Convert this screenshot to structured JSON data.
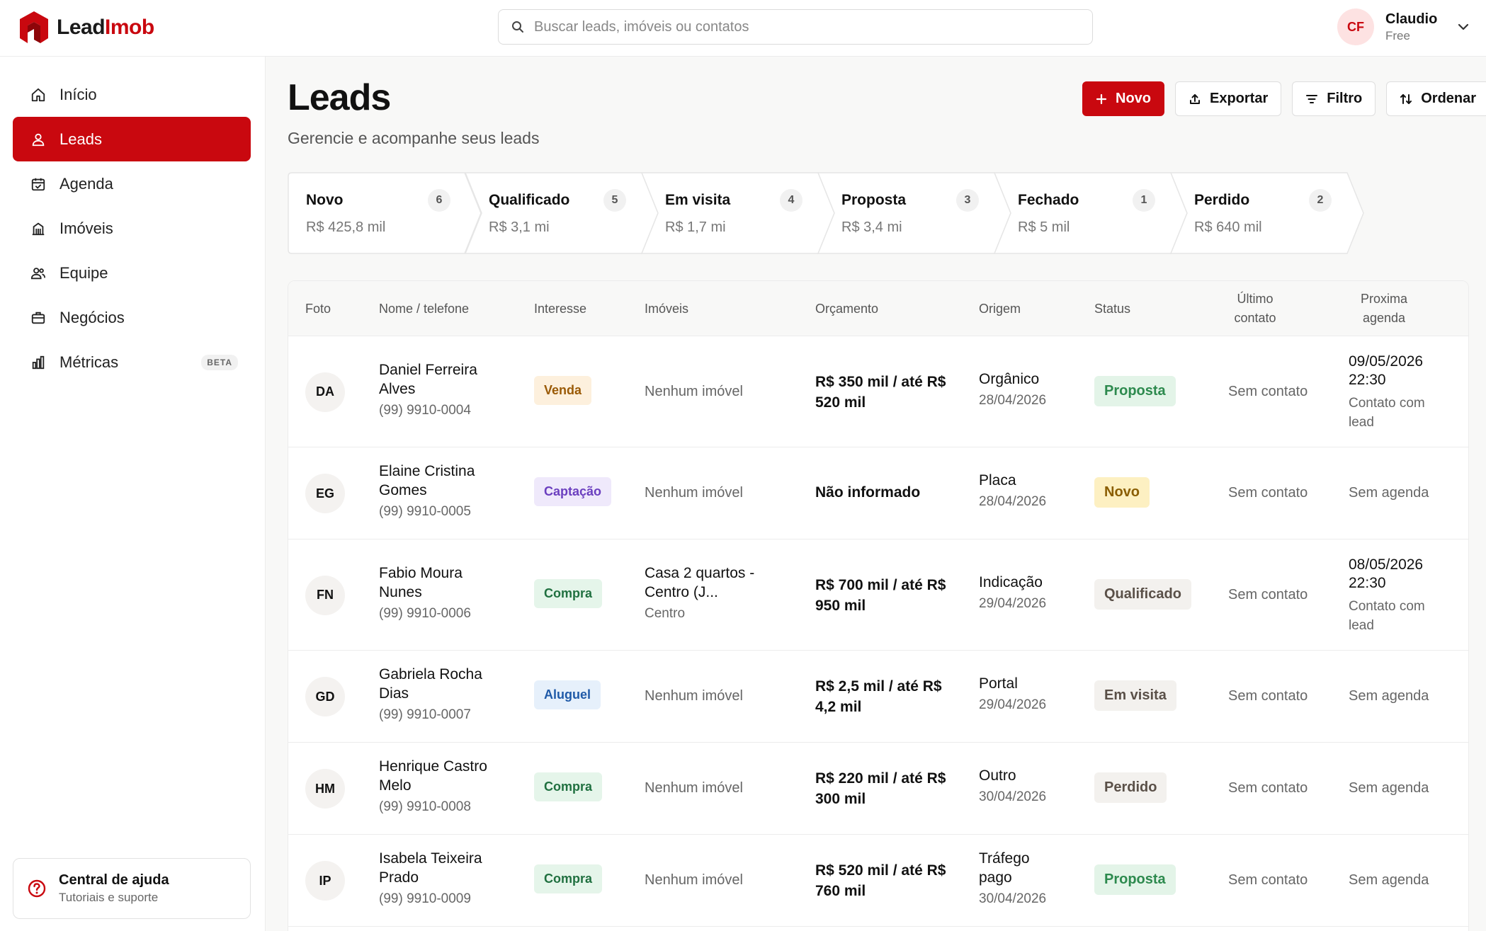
{
  "app": {
    "logo_a": "Lead",
    "logo_b": "Imob"
  },
  "search": {
    "placeholder": "Buscar leads, imóveis ou contatos"
  },
  "user": {
    "initials": "CF",
    "name": "Claudio",
    "plan": "Free"
  },
  "sidebar": {
    "items": [
      {
        "label": "Início",
        "icon": "home-icon"
      },
      {
        "label": "Leads",
        "icon": "user-icon",
        "active": true
      },
      {
        "label": "Agenda",
        "icon": "calendar-icon"
      },
      {
        "label": "Imóveis",
        "icon": "building-icon"
      },
      {
        "label": "Equipe",
        "icon": "users-icon"
      },
      {
        "label": "Negócios",
        "icon": "briefcase-icon"
      },
      {
        "label": "Métricas",
        "icon": "bar-chart-icon",
        "badge": "BETA"
      }
    ],
    "help": {
      "title": "Central de ajuda",
      "subtitle": "Tutoriais e suporte"
    }
  },
  "header": {
    "title": "Leads",
    "subtitle": "Gerencie e acompanhe seus leads"
  },
  "actions": {
    "new": "Novo",
    "export": "Exportar",
    "filter": "Filtro",
    "sort": "Ordenar"
  },
  "pipeline": [
    {
      "name": "Novo",
      "count": "6",
      "value": "R$ 425,8 mil"
    },
    {
      "name": "Qualificado",
      "count": "5",
      "value": "R$ 3,1 mi"
    },
    {
      "name": "Em visita",
      "count": "4",
      "value": "R$ 1,7 mi"
    },
    {
      "name": "Proposta",
      "count": "3",
      "value": "R$ 3,4 mi"
    },
    {
      "name": "Fechado",
      "count": "1",
      "value": "R$ 5 mil"
    },
    {
      "name": "Perdido",
      "count": "2",
      "value": "R$ 640 mil"
    }
  ],
  "table": {
    "headers": {
      "photo": "Foto",
      "name": "Nome / telefone",
      "interest": "Interesse",
      "properties": "Imóveis",
      "budget": "Orçamento",
      "origin": "Origem",
      "status": "Status",
      "last_contact_1": "Último",
      "last_contact_2": "contato",
      "next_1": "Proxima",
      "next_2": "agenda"
    },
    "rows": [
      {
        "initials": "DA",
        "name": "Daniel Ferreira Alves",
        "phone": "(99) 9910-0004",
        "interest": "Venda",
        "property": "Nenhum imóvel",
        "property_sub": "",
        "budget": "R$ 350 mil / até R$ 520 mil",
        "origin": "Orgânico",
        "origin_date": "28/04/2026",
        "status": "Proposta",
        "last_contact": "Sem contato",
        "agenda_date": "09/05/2026 22:30",
        "agenda_note": "Contato com lead"
      },
      {
        "initials": "EG",
        "name": "Elaine Cristina Gomes",
        "phone": "(99) 9910-0005",
        "interest": "Captação",
        "property": "Nenhum imóvel",
        "property_sub": "",
        "budget": "Não informado",
        "origin": "Placa",
        "origin_date": "28/04/2026",
        "status": "Novo",
        "last_contact": "Sem contato",
        "agenda_date": "",
        "agenda_note": "Sem agenda"
      },
      {
        "initials": "FN",
        "name": "Fabio Moura Nunes",
        "phone": "(99) 9910-0006",
        "interest": "Compra",
        "property": "Casa 2 quartos - Centro (J...",
        "property_sub": "Centro",
        "budget": "R$ 700 mil / até R$ 950 mil",
        "origin": "Indicação",
        "origin_date": "29/04/2026",
        "status": "Qualificado",
        "last_contact": "Sem contato",
        "agenda_date": "08/05/2026 22:30",
        "agenda_note": "Contato com lead"
      },
      {
        "initials": "GD",
        "name": "Gabriela Rocha Dias",
        "phone": "(99) 9910-0007",
        "interest": "Aluguel",
        "property": "Nenhum imóvel",
        "property_sub": "",
        "budget": "R$ 2,5 mil / até R$ 4,2 mil",
        "origin": "Portal",
        "origin_date": "29/04/2026",
        "status": "Em visita",
        "last_contact": "Sem contato",
        "agenda_date": "",
        "agenda_note": "Sem agenda"
      },
      {
        "initials": "HM",
        "name": "Henrique Castro Melo",
        "phone": "(99) 9910-0008",
        "interest": "Compra",
        "property": "Nenhum imóvel",
        "property_sub": "",
        "budget": "R$ 220 mil / até R$ 300 mil",
        "origin": "Outro",
        "origin_date": "30/04/2026",
        "status": "Perdido",
        "last_contact": "Sem contato",
        "agenda_date": "",
        "agenda_note": "Sem agenda"
      },
      {
        "initials": "IP",
        "name": "Isabela Teixeira Prado",
        "phone": "(99) 9910-0009",
        "interest": "Compra",
        "property": "Nenhum imóvel",
        "property_sub": "",
        "budget": "R$ 520 mil / até R$ 760 mil",
        "origin": "Tráfego pago",
        "origin_date": "30/04/2026",
        "status": "Proposta",
        "last_contact": "Sem contato",
        "agenda_date": "",
        "agenda_note": "Sem agenda"
      }
    ]
  },
  "colors": {
    "brand": "#c9080f",
    "interest": {
      "Venda": {
        "bg": "#fdf0dd",
        "fg": "#9a5a06"
      },
      "Captação": {
        "bg": "#efe9fb",
        "fg": "#6b3fbf"
      },
      "Compra": {
        "bg": "#e5f5ea",
        "fg": "#207040"
      },
      "Aluguel": {
        "bg": "#e6f0fb",
        "fg": "#1f5aa8"
      }
    },
    "status": {
      "Proposta": {
        "bg": "#e3f4e8",
        "fg": "#2d8a4e"
      },
      "Novo": {
        "bg": "#fdf0c2",
        "fg": "#8a5d00"
      },
      "Qualificado": {
        "bg": "#f3f1ee",
        "fg": "#5a5048"
      },
      "Em visita": {
        "bg": "#f3f1ee",
        "fg": "#5a5048"
      },
      "Perdido": {
        "bg": "#f3f1ee",
        "fg": "#5a5048"
      }
    }
  }
}
